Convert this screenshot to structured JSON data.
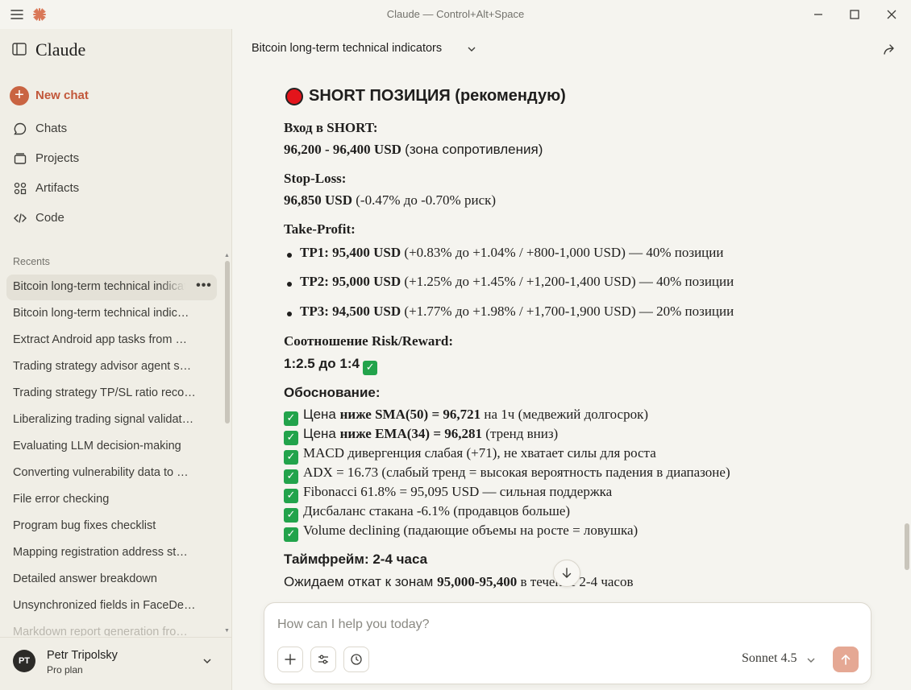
{
  "window": {
    "title": "Claude — Control+Alt+Space"
  },
  "sidebar": {
    "brand": "Claude",
    "nav": [
      {
        "label": "New chat",
        "icon": "plus-icon"
      },
      {
        "label": "Chats",
        "icon": "chat-bubble-icon"
      },
      {
        "label": "Projects",
        "icon": "folder-icon"
      },
      {
        "label": "Artifacts",
        "icon": "artifacts-icon"
      },
      {
        "label": "Code",
        "icon": "code-icon"
      }
    ],
    "recents_label": "Recents",
    "recents": [
      "Bitcoin long-term technical indicators",
      "Bitcoin long-term technical indic…",
      "Extract Android app tasks from …",
      "Trading strategy advisor agent s…",
      "Trading strategy TP/SL ratio reco…",
      "Liberalizing trading signal validat…",
      "Evaluating LLM decision-making",
      "Converting vulnerability data to …",
      "File error checking",
      "Program bug fixes checklist",
      "Mapping registration address st…",
      "Detailed answer breakdown",
      "Unsynchronized fields in FaceDe…",
      "Markdown report generation fro…"
    ],
    "more_label": "•••",
    "user": {
      "initials": "PT",
      "name": "Petr Tripolsky",
      "plan": "Pro plan"
    }
  },
  "header": {
    "chat_title": "Bitcoin long-term technical indicators"
  },
  "message": {
    "heading": "SHORT ПОЗИЦИЯ (рекомендую)",
    "entry_label": "Вход в SHORT:",
    "entry_value": "96,200 - 96,400 USD",
    "entry_note": "(зона сопротивления)",
    "sl_label": "Stop-Loss:",
    "sl_value": "96,850 USD",
    "sl_note": "(-0.47% до -0.70% риск)",
    "tp_label": "Take-Profit:",
    "tps": [
      {
        "name": "TP1: 95,400 USD",
        "note": "(+0.83% до +1.04% / +800-1,000 USD) — 40% позиции"
      },
      {
        "name": "TP2: 95,000 USD",
        "note": "(+1.25% до +1.45% / +1,200-1,400 USD) — 40% позиции"
      },
      {
        "name": "TP3: 94,500 USD",
        "note": "(+1.77% до +1.98% / +1,700-1,900 USD) — 20% позиции"
      }
    ],
    "rr_label": "Соотношение Risk/Reward:",
    "rr_value": "1:2.5 до 1:4",
    "reason_label": "Обоснование:",
    "reasons": [
      {
        "pre": "Цена ",
        "bold": "ниже SMA(50) = 96,721",
        "post": " на 1ч (медвежий долгосрок)"
      },
      {
        "pre": "Цена ",
        "bold": "ниже EMA(34) = 96,281",
        "post": " (тренд вниз)"
      },
      {
        "pre": "MACD дивергенция слабая (+71), не хватает силы для роста",
        "bold": "",
        "post": ""
      },
      {
        "pre": "ADX = 16.73 (слабый тренд = высокая вероятность падения в диапазоне)",
        "bold": "",
        "post": ""
      },
      {
        "pre": "Fibonacci 61.8% = 95,095 USD — сильная поддержка",
        "bold": "",
        "post": ""
      },
      {
        "pre": "Дисбаланс стакана -6.1% (продавцов больше)",
        "bold": "",
        "post": ""
      },
      {
        "pre": "Volume declining (падающие объемы на росте = ловушка)",
        "bold": "",
        "post": ""
      }
    ],
    "timeframe_label": "Таймфрейм: 2-4 часа",
    "timeframe_pre": "Ожидаем откат к зонам ",
    "timeframe_bold": "95,000-95,400",
    "timeframe_post": " в течение 2-4 часов"
  },
  "composer": {
    "placeholder": "How can I help you today?",
    "model": "Sonnet 4.5"
  },
  "colors": {
    "accent": "#c96442",
    "check_green": "#22a34b",
    "red_dot": "#e3141b",
    "send_disabled": "#e5a894"
  }
}
